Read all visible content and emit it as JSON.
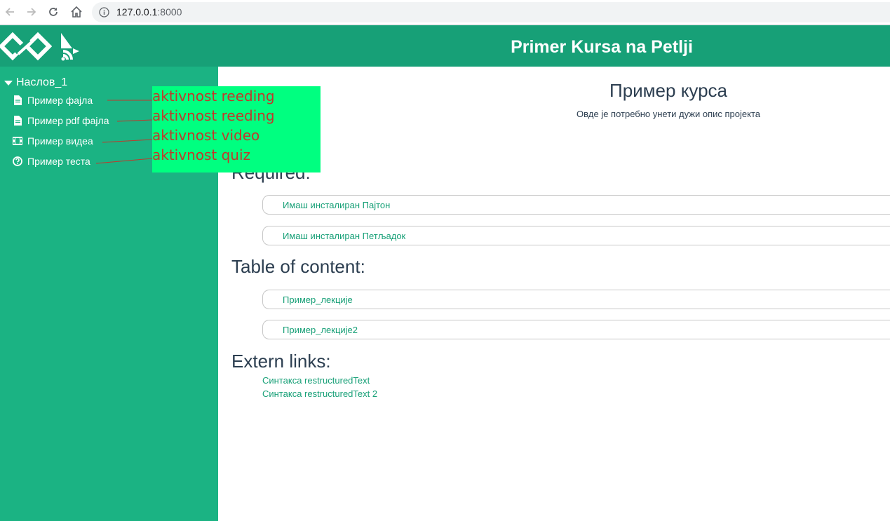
{
  "browser": {
    "url_host": "127.0.0.1",
    "url_port": ":8000"
  },
  "header": {
    "title": "Primer Kursa na Petlji",
    "background": "#17a077"
  },
  "sidebar": {
    "section": "Наслов_1",
    "background": "#1bb383",
    "items": [
      {
        "label": "Пример фајла",
        "icon": "file-icon"
      },
      {
        "label": "Пример pdf фајла",
        "icon": "file-icon"
      },
      {
        "label": "Пример видеа",
        "icon": "film-icon"
      },
      {
        "label": "Пример теста",
        "icon": "question-circle-icon"
      }
    ]
  },
  "annotations": [
    "aktivnost reeding",
    "aktivnost reeding",
    "aktivnost video",
    "aktivnost quiz"
  ],
  "main": {
    "course_title": "Пример курса",
    "course_description": "Овде је потребно унети дужи опис пројекта",
    "required_heading": "Required:",
    "required_items": [
      "Имаш инсталиран Пајтон",
      "Имаш инсталиран Петљадок"
    ],
    "toc_heading": "Table of content:",
    "toc_items": [
      "Пример_лекције",
      "Пример_лекције2"
    ],
    "extern_heading": "Extern links:",
    "extern_links": [
      "Синтакса restructuredText",
      "Синтакса restructuredText 2"
    ]
  }
}
